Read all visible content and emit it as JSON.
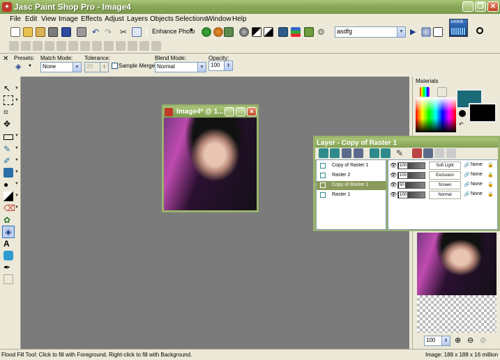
{
  "app": {
    "title": "Jasc Paint Shop Pro - Image4"
  },
  "menu": [
    "File",
    "Edit",
    "View",
    "Image",
    "Effects",
    "Adjust",
    "Layers",
    "Objects",
    "Selections",
    "Window",
    "Help"
  ],
  "toolbar": {
    "enhance_label": "Enhance Photo",
    "script_value": "asdfg",
    "tray_label": "140KB"
  },
  "tool_options": {
    "presets_label": "Presets:",
    "match_mode_label": "Match Mode:",
    "match_mode_value": "None",
    "tolerance_label": "Tolerance:",
    "tolerance_value": "20",
    "sample_merged_label": "Sample Merged",
    "blend_mode_label": "Blend Mode:",
    "blend_mode_value": "Normal",
    "opacity_label": "Opacity:",
    "opacity_value": "100"
  },
  "image_window": {
    "title": "Image4* @ 1..."
  },
  "layers_palette": {
    "title": "Layer - Copy of Raster 1",
    "layers": [
      {
        "name": "Copy of Raster 1",
        "opacity": "100",
        "blend": "Soft Light",
        "mask": "None",
        "selected": false
      },
      {
        "name": "Raster 2",
        "opacity": "100",
        "blend": "Exclusion",
        "mask": "None",
        "selected": false
      },
      {
        "name": "Copy of Raster 1",
        "opacity": "50",
        "blend": "Screen",
        "mask": "None",
        "selected": true
      },
      {
        "name": "Raster 1",
        "opacity": "100",
        "blend": "Normal",
        "mask": "None",
        "selected": false
      }
    ]
  },
  "materials": {
    "title": "Materials",
    "foreground": "#1a6a78",
    "background": "#000000"
  },
  "overview": {
    "zoom_value": "100"
  },
  "status": {
    "left": "Flood Fill Tool: Click to fill with Foreground. Right-click to fill with Background.",
    "right": "Image:  188 x 188 x 16 million"
  }
}
